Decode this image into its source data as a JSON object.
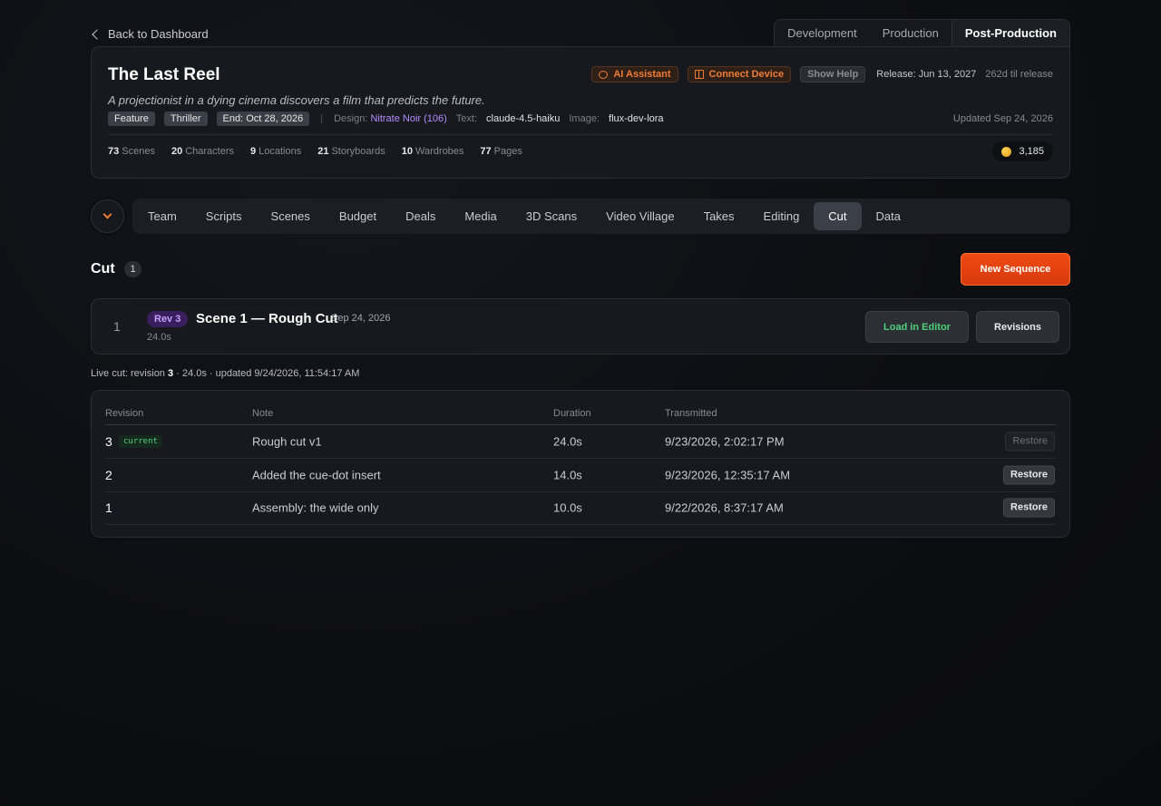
{
  "header": {
    "back_label": "Back to Dashboard",
    "phases": [
      "Development",
      "Production",
      "Post-Production"
    ],
    "active_phase": "Post-Production"
  },
  "project": {
    "title": "The Last Reel",
    "logline": "A projectionist in a dying cinema discovers a film that predicts the future.",
    "actions": {
      "ai": "AI Assistant",
      "connect": "Connect Device",
      "help": "Show Help"
    },
    "release": "Release: Jun 13, 2027",
    "til_release": "262d til release",
    "tags": [
      "Feature",
      "Thriller",
      "End: Oct 28, 2026"
    ],
    "meta": {
      "design_label": "Design:",
      "design_value": "Nitrate Noir (106)",
      "text_label": "Text:",
      "text_value": "claude-4.5-haiku",
      "image_label": "Image:",
      "image_value": "flux-dev-lora"
    },
    "updated": "Updated Sep 24, 2026",
    "stats": [
      {
        "count": "73",
        "label": "Scenes"
      },
      {
        "count": "20",
        "label": "Characters"
      },
      {
        "count": "9",
        "label": "Locations"
      },
      {
        "count": "21",
        "label": "Storyboards"
      },
      {
        "count": "10",
        "label": "Wardrobes"
      },
      {
        "count": "77",
        "label": "Pages"
      }
    ],
    "credits": "3,185"
  },
  "nav": {
    "items": [
      "Team",
      "Scripts",
      "Scenes",
      "Budget",
      "Deals",
      "Media",
      "3D Scans",
      "Video Village",
      "Takes",
      "Editing",
      "Cut",
      "Data"
    ],
    "active": "Cut"
  },
  "cut": {
    "title": "Cut",
    "count": "1",
    "new_sequence_label": "New Sequence",
    "sequence": {
      "index": "1",
      "rev_badge": "Rev 3",
      "name": "Scene 1 — Rough Cut",
      "date": "Sep 24, 2026",
      "duration": "24.0s",
      "load_label": "Load in Editor",
      "revisions_label": "Revisions"
    },
    "live": {
      "prefix": "Live cut: revision",
      "revision": "3",
      "suffix": "· 24.0s · updated 9/24/2026, 11:54:17 AM"
    },
    "table": {
      "headers": [
        "Revision",
        "Note",
        "Duration",
        "Transmitted"
      ],
      "rows": [
        {
          "revision": "3",
          "badge": "current",
          "note": "Rough cut v1",
          "duration": "24.0s",
          "transmitted": "9/23/2026, 2:02:17 PM",
          "action": "Restore"
        },
        {
          "revision": "2",
          "badge": "",
          "note": "Added the cue-dot insert",
          "duration": "14.0s",
          "transmitted": "9/23/2026, 12:35:17 AM",
          "action": "Restore"
        },
        {
          "revision": "1",
          "badge": "",
          "note": "Assembly: the wide only",
          "duration": "10.0s",
          "transmitted": "9/22/2026, 8:37:17 AM",
          "action": "Restore"
        }
      ]
    }
  },
  "colors": {
    "accent": "#f04a14",
    "success": "#4fd07a",
    "purple": "#b48cff",
    "background": "#0d0e12"
  }
}
